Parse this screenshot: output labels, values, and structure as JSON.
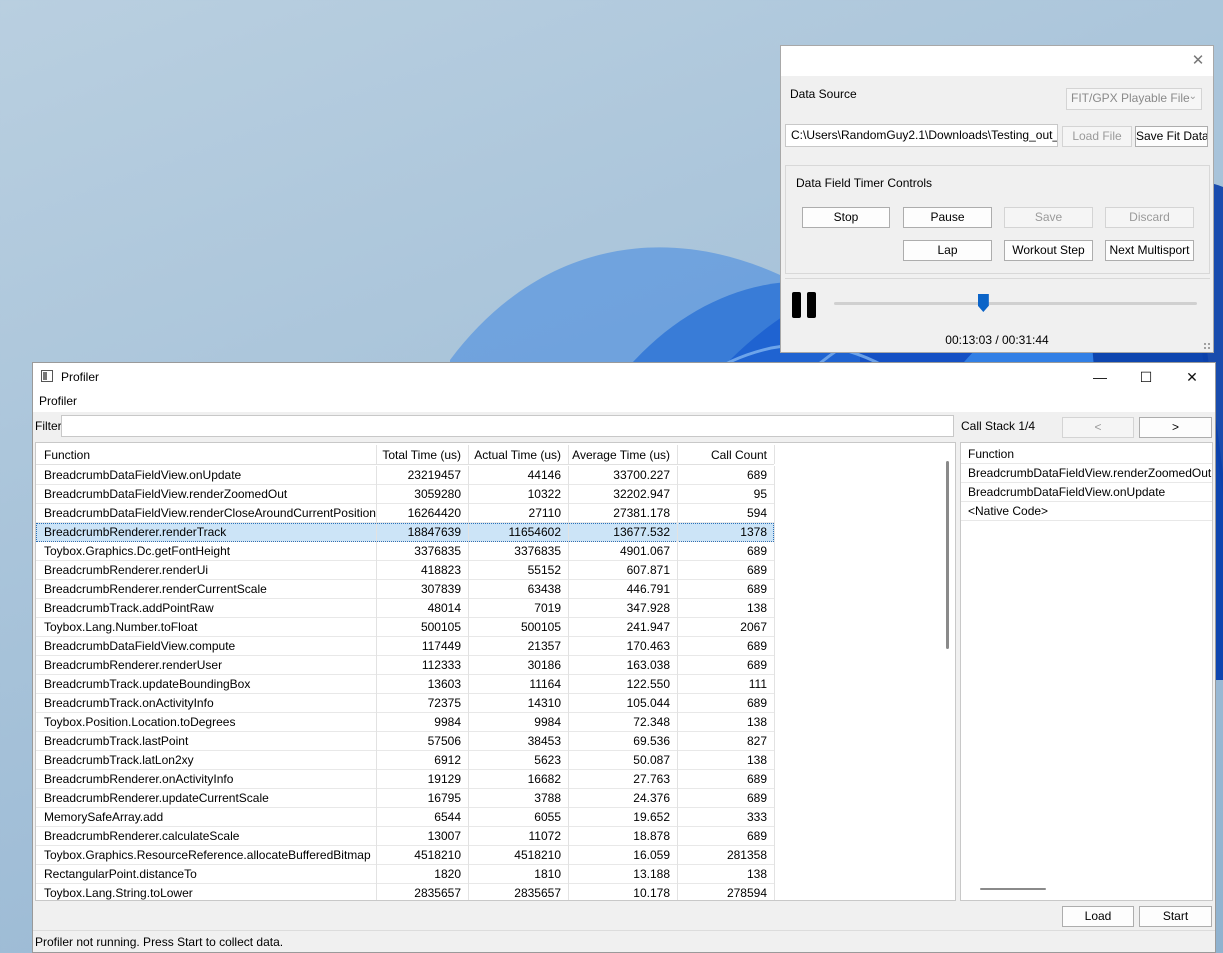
{
  "simulator": {
    "close_glyph": "✕",
    "data_source_label": "Data Source",
    "data_source_value": "FIT/GPX Playable File",
    "file_path": "C:\\Users\\RandomGuy2.1\\Downloads\\Testing_out_",
    "load_file": "Load File",
    "save_fit_data": "Save Fit Data",
    "timer_group_title": "Data Field Timer Controls",
    "stop": "Stop",
    "pause": "Pause",
    "save": "Save",
    "discard": "Discard",
    "lap": "Lap",
    "workout_step": "Workout Step",
    "next_multisport": "Next Multisport",
    "playback_progress": 0.41,
    "time": "00:13:03 / 00:31:44"
  },
  "profiler": {
    "title": "Profiler",
    "menu": "Profiler",
    "minimize_glyph": "—",
    "maximize_glyph": "☐",
    "close_glyph": "✕",
    "filter_label": "Filter",
    "filter_value": "",
    "call_stack_label": "Call Stack 1/4",
    "prev": "<",
    "next": ">",
    "columns": [
      "Function",
      "Total Time (us)",
      "Actual Time (us)",
      "Average Time (us)",
      "Call Count"
    ],
    "selected_row": 3,
    "rows": [
      [
        "BreadcrumbDataFieldView.onUpdate",
        "23219457",
        "44146",
        "33700.227",
        "689"
      ],
      [
        "BreadcrumbDataFieldView.renderZoomedOut",
        "3059280",
        "10322",
        "32202.947",
        "95"
      ],
      [
        "BreadcrumbDataFieldView.renderCloseAroundCurrentPosition",
        "16264420",
        "27110",
        "27381.178",
        "594"
      ],
      [
        "BreadcrumbRenderer.renderTrack",
        "18847639",
        "11654602",
        "13677.532",
        "1378"
      ],
      [
        "Toybox.Graphics.Dc.getFontHeight",
        "3376835",
        "3376835",
        "4901.067",
        "689"
      ],
      [
        "BreadcrumbRenderer.renderUi",
        "418823",
        "55152",
        "607.871",
        "689"
      ],
      [
        "BreadcrumbRenderer.renderCurrentScale",
        "307839",
        "63438",
        "446.791",
        "689"
      ],
      [
        "BreadcrumbTrack.addPointRaw",
        "48014",
        "7019",
        "347.928",
        "138"
      ],
      [
        "Toybox.Lang.Number.toFloat",
        "500105",
        "500105",
        "241.947",
        "2067"
      ],
      [
        "BreadcrumbDataFieldView.compute",
        "117449",
        "21357",
        "170.463",
        "689"
      ],
      [
        "BreadcrumbRenderer.renderUser",
        "112333",
        "30186",
        "163.038",
        "689"
      ],
      [
        "BreadcrumbTrack.updateBoundingBox",
        "13603",
        "11164",
        "122.550",
        "111"
      ],
      [
        "BreadcrumbTrack.onActivityInfo",
        "72375",
        "14310",
        "105.044",
        "689"
      ],
      [
        "Toybox.Position.Location.toDegrees",
        "9984",
        "9984",
        "72.348",
        "138"
      ],
      [
        "BreadcrumbTrack.lastPoint",
        "57506",
        "38453",
        "69.536",
        "827"
      ],
      [
        "BreadcrumbTrack.latLon2xy",
        "6912",
        "5623",
        "50.087",
        "138"
      ],
      [
        "BreadcrumbRenderer.onActivityInfo",
        "19129",
        "16682",
        "27.763",
        "689"
      ],
      [
        "BreadcrumbRenderer.updateCurrentScale",
        "16795",
        "3788",
        "24.376",
        "689"
      ],
      [
        "MemorySafeArray.add",
        "6544",
        "6055",
        "19.652",
        "333"
      ],
      [
        "BreadcrumbRenderer.calculateScale",
        "13007",
        "11072",
        "18.878",
        "689"
      ],
      [
        "Toybox.Graphics.ResourceReference.allocateBufferedBitmap",
        "4518210",
        "4518210",
        "16.059",
        "281358"
      ],
      [
        "RectangularPoint.distanceTo",
        "1820",
        "1810",
        "13.188",
        "138"
      ],
      [
        "Toybox.Lang.String.toLower",
        "2835657",
        "2835657",
        "10.178",
        "278594"
      ]
    ],
    "call_stack": {
      "header": "Function",
      "items": [
        "BreadcrumbDataFieldView.renderZoomedOut",
        "BreadcrumbDataFieldView.onUpdate",
        "<Native Code>"
      ]
    },
    "load": "Load",
    "start": "Start",
    "status": "Profiler not running. Press Start to collect data."
  }
}
